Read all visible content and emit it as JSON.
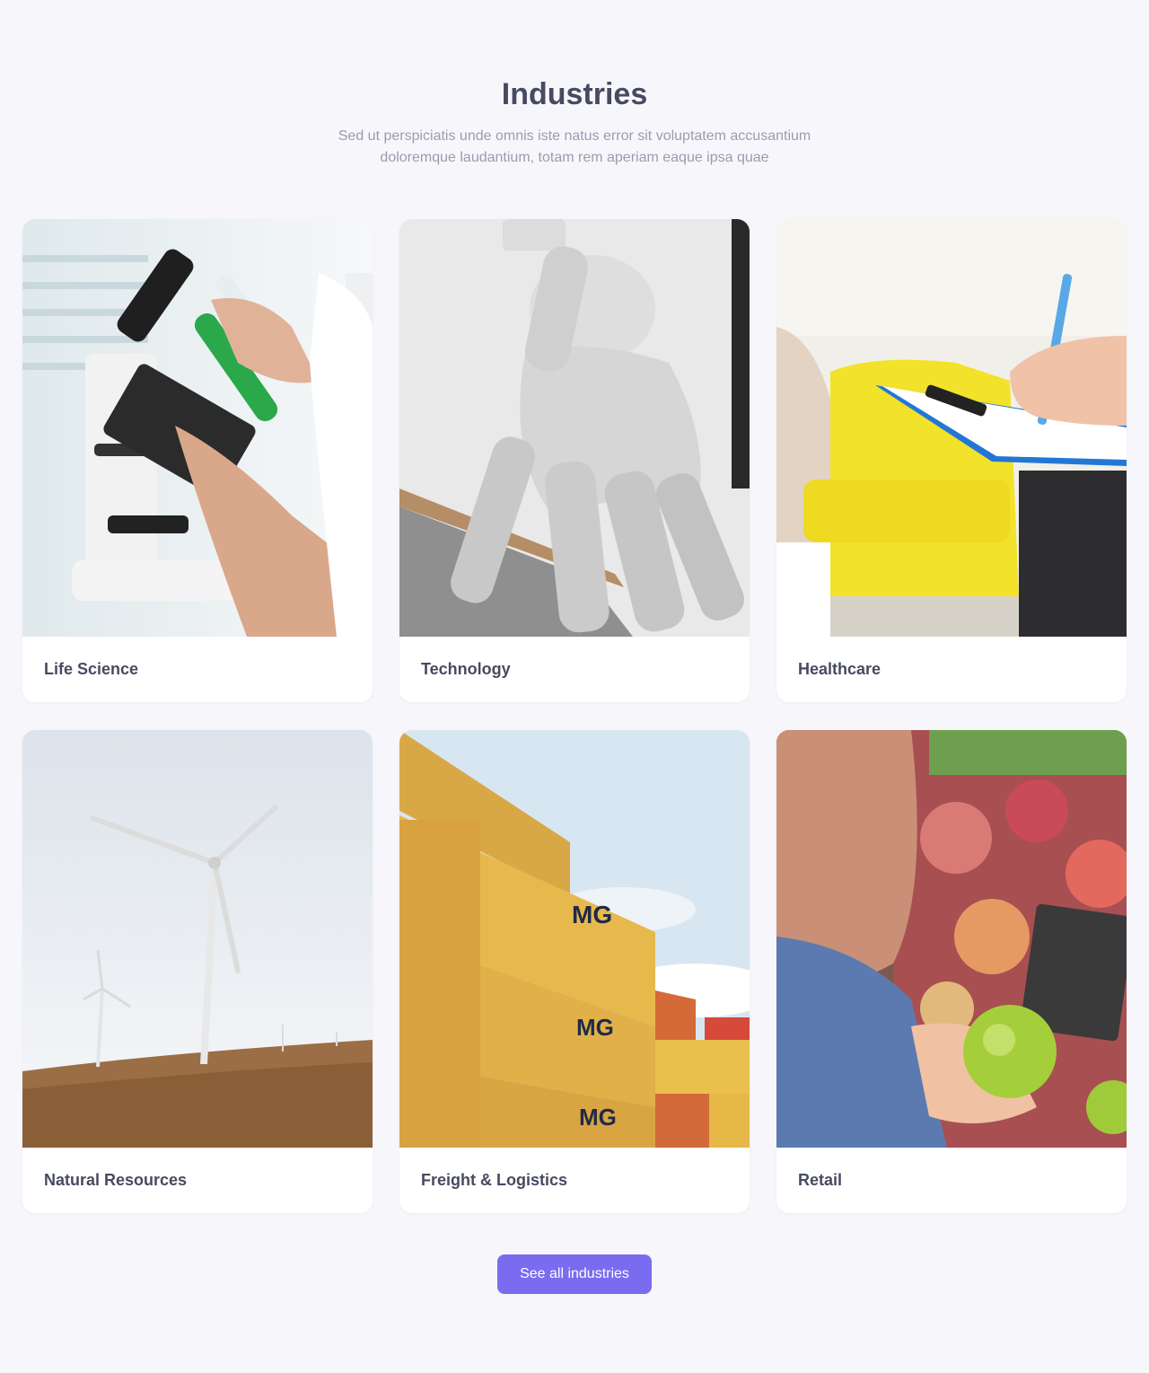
{
  "section": {
    "title": "Industries",
    "subtitle": "Sed ut perspiciatis unde omnis iste natus error sit voluptatem accusantium doloremque laudantium, totam rem aperiam eaque ipsa quae"
  },
  "industries": [
    {
      "label": "Life Science",
      "image": "microscope-test-tube-photo"
    },
    {
      "label": "Technology",
      "image": "robotic-hand-photo"
    },
    {
      "label": "Healthcare",
      "image": "clipboard-notes-photo"
    },
    {
      "label": "Natural Resources",
      "image": "wind-turbines-photo"
    },
    {
      "label": "Freight & Logistics",
      "image": "shipping-containers-photo"
    },
    {
      "label": "Retail",
      "image": "apples-market-photo"
    }
  ],
  "cta": {
    "label": "See all industries",
    "color": "#7a6cf0"
  }
}
